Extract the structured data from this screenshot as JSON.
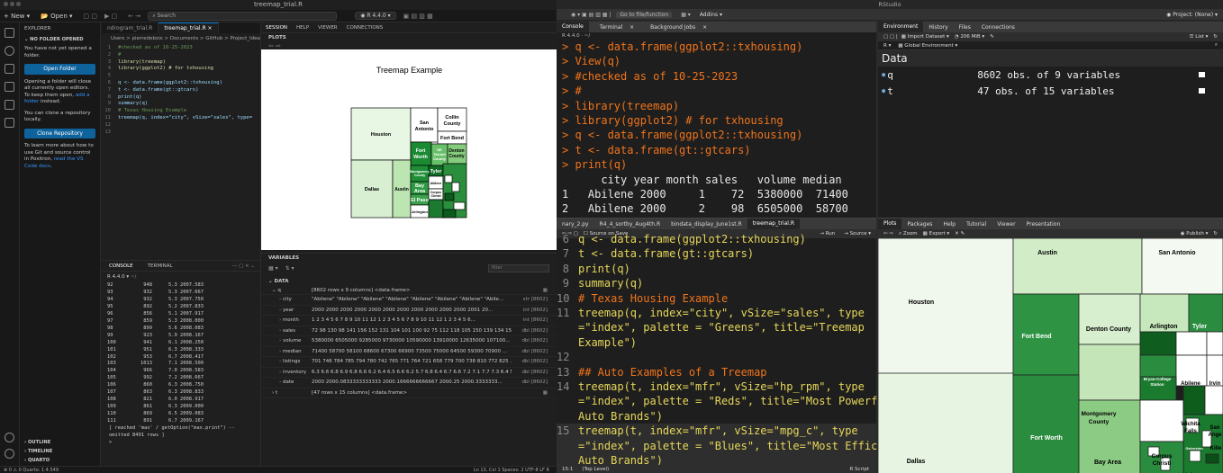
{
  "positron": {
    "window_title": "treemap_trial.R",
    "menu": {
      "new": "New",
      "open": "Open",
      "search": "Search",
      "r_version": "R 4.4.0"
    },
    "explorer": {
      "header": "EXPLORER",
      "section": "NO FOLDER OPENED",
      "p1": "You have not yet opened a folder.",
      "open_folder_btn": "Open Folder",
      "p2": "Opening a folder will close all currently open editors. To keep them open,",
      "p2_link": "add a folder",
      "p2_end": "instead.",
      "p3": "You can clone a repository locally.",
      "clone_btn": "Clone Repository",
      "p4": "To learn more about how to use Git and source control in Positron,",
      "p4_link": "read the VS Code docs",
      "outline": "OUTLINE",
      "timeline": "TIMELINE",
      "quarto": "QUARTO"
    },
    "editor": {
      "tabs": [
        "ndrogram_trial.R",
        "treemap_trial.R"
      ],
      "breadcrumb": "Users > pierredebois > Documents > GitHub > Project_Ideas",
      "lines": [
        {
          "n": "1",
          "t": "#checked as of 10-25-2023",
          "k": "cmt"
        },
        {
          "n": "2",
          "t": "#",
          "k": "cmt"
        },
        {
          "n": "3",
          "t": "library(treemap)",
          "k": "fn"
        },
        {
          "n": "4",
          "t": "library(ggplot2) # for txhousing",
          "k": "fn"
        },
        {
          "n": "5",
          "t": "",
          "k": "plain"
        },
        {
          "n": "6",
          "t": "q <- data.frame(ggplot2::txhousing)",
          "k": "plain"
        },
        {
          "n": "7",
          "t": "t <- data.frame(gt::gtcars)",
          "k": "plain"
        },
        {
          "n": "8",
          "t": "print(q)",
          "k": "plain"
        },
        {
          "n": "9",
          "t": "summary(q)",
          "k": "plain"
        },
        {
          "n": "10",
          "t": "# Texas Housing Example",
          "k": "cmt"
        },
        {
          "n": "11",
          "t": "treemap(q, index=\"city\", vSize=\"sales\", type=",
          "k": "plain"
        },
        {
          "n": "12",
          "t": "",
          "k": "plain"
        },
        {
          "n": "13",
          "t": "",
          "k": "plain"
        }
      ]
    },
    "plots_panel": {
      "tabs": [
        "SESSION",
        "HELP",
        "VIEWER",
        "CONNECTIONS"
      ],
      "section": "PLOTS",
      "plot_title": "Treemap Example",
      "cells": [
        "Houston",
        "San Antonio",
        "Collin County",
        "Fort Bend",
        "Fort Worth",
        "NE Tarrant County",
        "Denton County",
        "Dallas",
        "Austin",
        "Montgomery County",
        "Bay Area",
        "El Paso",
        "Tyler",
        "Arlington",
        "Corpus Christi"
      ]
    },
    "console": {
      "tabs": [
        "CONSOLE",
        "TERMINAL"
      ],
      "r_label": "R 4.4.0",
      "path": "~/",
      "rows": [
        [
          "92",
          "948",
          "5.3 2007.583"
        ],
        [
          "93",
          "932",
          "5.3 2007.667"
        ],
        [
          "94",
          "932",
          "5.3 2007.750"
        ],
        [
          "95",
          "892",
          "5.2 2007.833"
        ],
        [
          "96",
          "856",
          "5.1 2007.917"
        ],
        [
          "97",
          "859",
          "5.3 2008.000"
        ],
        [
          "98",
          "899",
          "5.6 2008.083"
        ],
        [
          "99",
          "923",
          "5.9 2008.167"
        ],
        [
          "100",
          "941",
          "6.1 2008.250"
        ],
        [
          "101",
          "951",
          "6.3 2008.333"
        ],
        [
          "102",
          "953",
          "6.7 2008.417"
        ],
        [
          "103",
          "1013",
          "7.1 2008.500"
        ],
        [
          "104",
          "966",
          "7.0 2008.583"
        ],
        [
          "105",
          "992",
          "7.2 2008.667"
        ],
        [
          "106",
          "860",
          "6.3 2008.750"
        ],
        [
          "107",
          "863",
          "6.3 2008.833"
        ],
        [
          "108",
          "821",
          "6.0 2008.917"
        ],
        [
          "109",
          "861",
          "6.3 2009.000"
        ],
        [
          "110",
          "869",
          "6.5 2009.083"
        ],
        [
          "111",
          "891",
          "6.7 2009.167"
        ]
      ],
      "note1": "[ reached 'max' / getOption(\"max.print\") --",
      "note2": "omitted 8491 rows ]",
      "prompt": ">"
    },
    "variables": {
      "header": "VARIABLES",
      "filter_placeholder": "filter",
      "section": "DATA",
      "q_name": "q",
      "q_value": "[8602 rows x 9 columns] <data.frame>",
      "cols": [
        {
          "name": "city",
          "value": "\"Abilene\" \"Abilene\" \"Abilene\" \"Abilene\" \"Abilene\" \"Abilene\" \"Abilene\" \"Abile...",
          "type": "str [8602]"
        },
        {
          "name": "year",
          "value": "2000 2000 2000 2000 2000 2000 2000 2000 2000 2000 2000 2001 20...",
          "type": "int [8602]"
        },
        {
          "name": "month",
          "value": "1 2 3 4 5 6 7 8 9 10 11 12 1 2 3 4 5 6 7 8 9 10 11 12 1 2 3 4 5 6...",
          "type": "int [8602]"
        },
        {
          "name": "sales",
          "value": "72 98 130 98 141 156 152 131 104 101 100 92 75 112 118 105 150 139 134 151 1...",
          "type": "dbl [8602]"
        },
        {
          "name": "volume",
          "value": "5380000 6505000 9285000 9730000 10590000 13910000 12635000 107100...",
          "type": "dbl [8602]"
        },
        {
          "name": "median",
          "value": "71400 58700 58100 68600 67300 66900 73500 75000 64500 59300 70900 ...",
          "type": "dbl [8602]"
        },
        {
          "name": "listings",
          "value": "701 746 784 785 794 780 742 765 771 764 721 658 779 700 738 810 772 825 ...",
          "type": "dbl [8602]"
        },
        {
          "name": "inventory",
          "value": "6.3 6.6 6.8 6.9 6.8 6.6 6.2 6.4 6.5 6.6 6.2 5.7 6.8 6.4 6.7 6.6 7.2 7.1 7.7 7.3 6.4 5...",
          "type": "dbl [8602]"
        },
        {
          "name": "date",
          "value": "2000 2000.0833333333333 2000.1666666666667 2000.25 2000.3333333...",
          "type": "dbl [8602]"
        }
      ],
      "t_name": "t",
      "t_value": "[47 rows x 15 columns] <data.frame>"
    },
    "status": {
      "left": "⊗ 0 ⚠ 0   Quarto: 1.4.549",
      "right": "Ln 13, Col 1   Spaces: 2   UTF-8   LF   R"
    }
  },
  "rstudio": {
    "app_title": "RStudio",
    "toolbar": {
      "goto": "Go to file/function",
      "addins": "Addins",
      "project": "Project: (None)"
    },
    "console_tabs": [
      "Console",
      "Terminal",
      "Background Jobs"
    ],
    "r_version_path": "R 4.4.0 · ~/",
    "console_lines": [
      "> q <- data.frame(ggplot2::txhousing)",
      "> View(q)",
      "> #checked as of 10-25-2023",
      "> #",
      "> library(treemap)",
      "> library(ggplot2) # for txhousing",
      "> q <- data.frame(ggplot2::txhousing)",
      "> t <- data.frame(gt::gtcars)",
      "> print(q)"
    ],
    "console_output_header": "      city year month sales   volume median",
    "console_output_rows": [
      "1   Abilene 2000     1    72  5380000  71400",
      "2   Abilene 2000     2    98  6505000  58700"
    ],
    "source_tabs": [
      "nary_2.py",
      "R4_4_sortby_Aug4th.R",
      "bindata_display_June1st.R",
      "treemap_trial.R"
    ],
    "source_toolbar": {
      "source_on_save": "Source on Save",
      "run": "Run",
      "source": "Source"
    },
    "source_lines": [
      {
        "n": "6",
        "t": "q <- data.frame(ggplot2::txhousing)"
      },
      {
        "n": "7",
        "t": "t <- data.frame(gt::gtcars)"
      },
      {
        "n": "8",
        "t": "print(q)"
      },
      {
        "n": "9",
        "t": "summary(q)"
      },
      {
        "n": "10",
        "t": "# Texas Housing Example"
      },
      {
        "n": "11",
        "t": "treemap(q, index=\"city\", vSize=\"sales\", type"
      },
      {
        "n": "",
        "t": "=\"index\", palette = \"Greens\", title=\"Treemap"
      },
      {
        "n": "",
        "t": "Example\")"
      },
      {
        "n": "12",
        "t": ""
      },
      {
        "n": "13",
        "t": "## Auto Examples of a Treemap"
      },
      {
        "n": "14",
        "t": "treemap(t, index=\"mfr\", vSize=\"hp_rpm\", type"
      },
      {
        "n": "",
        "t": "=\"index\", palette = \"Reds\", title=\"Most Powerful"
      },
      {
        "n": "",
        "t": "Auto Brands\")"
      },
      {
        "n": "15",
        "t": "treemap(t, index=\"mfr\", vSize=\"mpg_c\", type"
      },
      {
        "n": "",
        "t": "=\"index\", palette = \"Blues\", title=\"Most Efficient"
      },
      {
        "n": "",
        "t": "Auto Brands\")"
      }
    ],
    "source_status": {
      "pos": "15:1",
      "scope": "(Top Level)",
      "type": "R Script"
    },
    "env": {
      "tabs": [
        "Environment",
        "History",
        "Files",
        "Connections"
      ],
      "import": "Import Dataset",
      "mem": "206 MiB",
      "list": "List",
      "r": "R",
      "scope": "Global Environment",
      "section": "Data",
      "rows": [
        {
          "name": "q",
          "desc": "8602 obs. of 9 variables"
        },
        {
          "name": "t",
          "desc": "47 obs. of 15 variables"
        }
      ]
    },
    "plots": {
      "tabs": [
        "Plots",
        "Packages",
        "Help",
        "Tutorial",
        "Viewer",
        "Presentation"
      ],
      "zoom": "Zoom",
      "export": "Export",
      "publish": "Publish",
      "cells": [
        "Houston",
        "Austin",
        "San Antonio",
        "Fort Bend",
        "Denton County",
        "Arlington",
        "Tyler",
        "Bryan-College Station",
        "Abilene",
        "Irvin",
        "Montgomery County",
        "Beaumont",
        "Wichita Falls",
        "San Ange",
        "Fort Worth",
        "Dallas",
        "Bay Area",
        "Corpus Christi",
        "Galveston",
        "Kille",
        "Harlingen"
      ]
    }
  },
  "colors": {
    "accent": "#0e639c",
    "console_orange": "#f0741b",
    "green_dark": "#1a7a2e"
  }
}
